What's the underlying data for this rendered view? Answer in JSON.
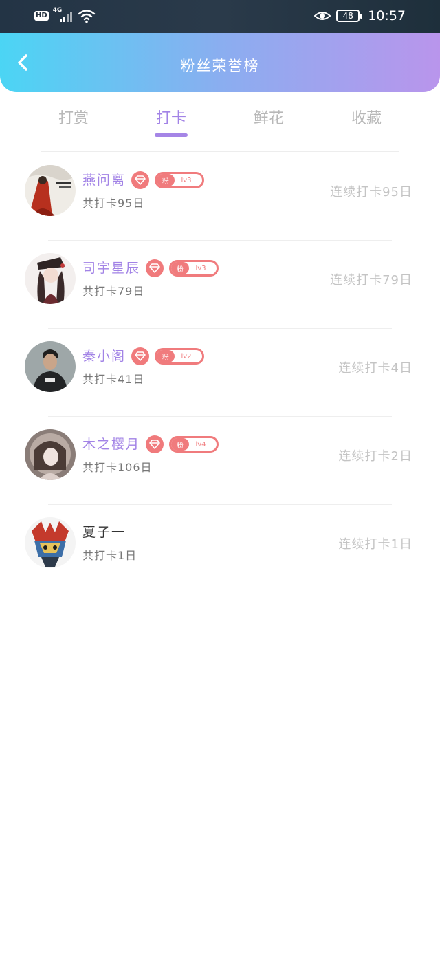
{
  "status_bar": {
    "hd_label": "HD",
    "network_label": "4G",
    "battery_level": "48",
    "time": "10:57"
  },
  "header": {
    "title": "粉丝荣誉榜"
  },
  "tabs": [
    {
      "label": "打赏",
      "active": false
    },
    {
      "label": "打卡",
      "active": true
    },
    {
      "label": "鲜花",
      "active": false
    },
    {
      "label": "收藏",
      "active": false
    }
  ],
  "fans": [
    {
      "name": "燕问离",
      "badge_label": "粉",
      "level": "lv3",
      "total": "共打卡95日",
      "streak": "连续打卡95日",
      "has_badges": true
    },
    {
      "name": "司宇星辰",
      "badge_label": "粉",
      "level": "lv3",
      "total": "共打卡79日",
      "streak": "连续打卡79日",
      "has_badges": true
    },
    {
      "name": "秦小阁",
      "badge_label": "粉",
      "level": "lv2",
      "total": "共打卡41日",
      "streak": "连续打卡4日",
      "has_badges": true
    },
    {
      "name": "木之樱月",
      "badge_label": "粉",
      "level": "lv4",
      "total": "共打卡106日",
      "streak": "连续打卡2日",
      "has_badges": true
    },
    {
      "name": "夏子一",
      "total": "共打卡1日",
      "streak": "连续打卡1日",
      "has_badges": false
    }
  ],
  "colors": {
    "accent_purple": "#a283e6",
    "badge_red": "#f07b7d",
    "header_gradient_start": "#4bd5f4",
    "header_gradient_end": "#b995ec"
  }
}
